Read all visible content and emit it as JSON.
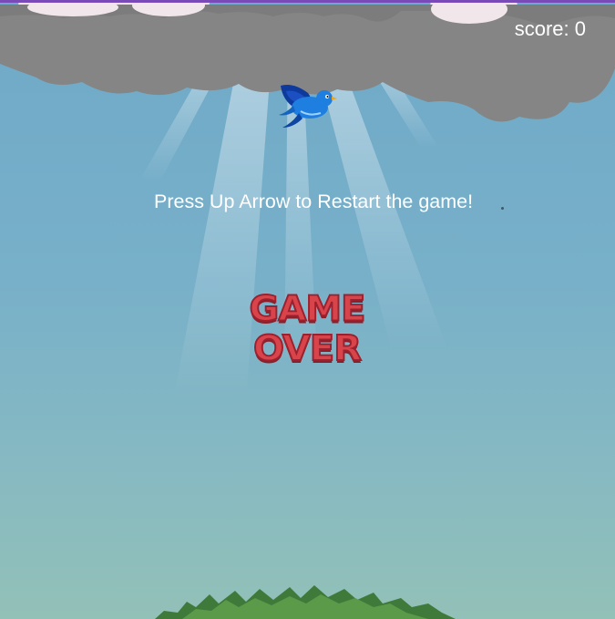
{
  "hud": {
    "score_text": "score: 0"
  },
  "message": {
    "restart_text": "Press Up Arrow to Restart the game!"
  },
  "game_over": {
    "label": "GAME OVER"
  },
  "colors": {
    "accent_bar": "#7a4bb8",
    "sky_top": "#6fa9c8",
    "sky_bottom": "#93c1b8",
    "cloud": "#858585",
    "game_over_red": "#d8444a",
    "bird_blue": "#1e7fe0"
  },
  "icons": {
    "bird": "bird-icon"
  }
}
